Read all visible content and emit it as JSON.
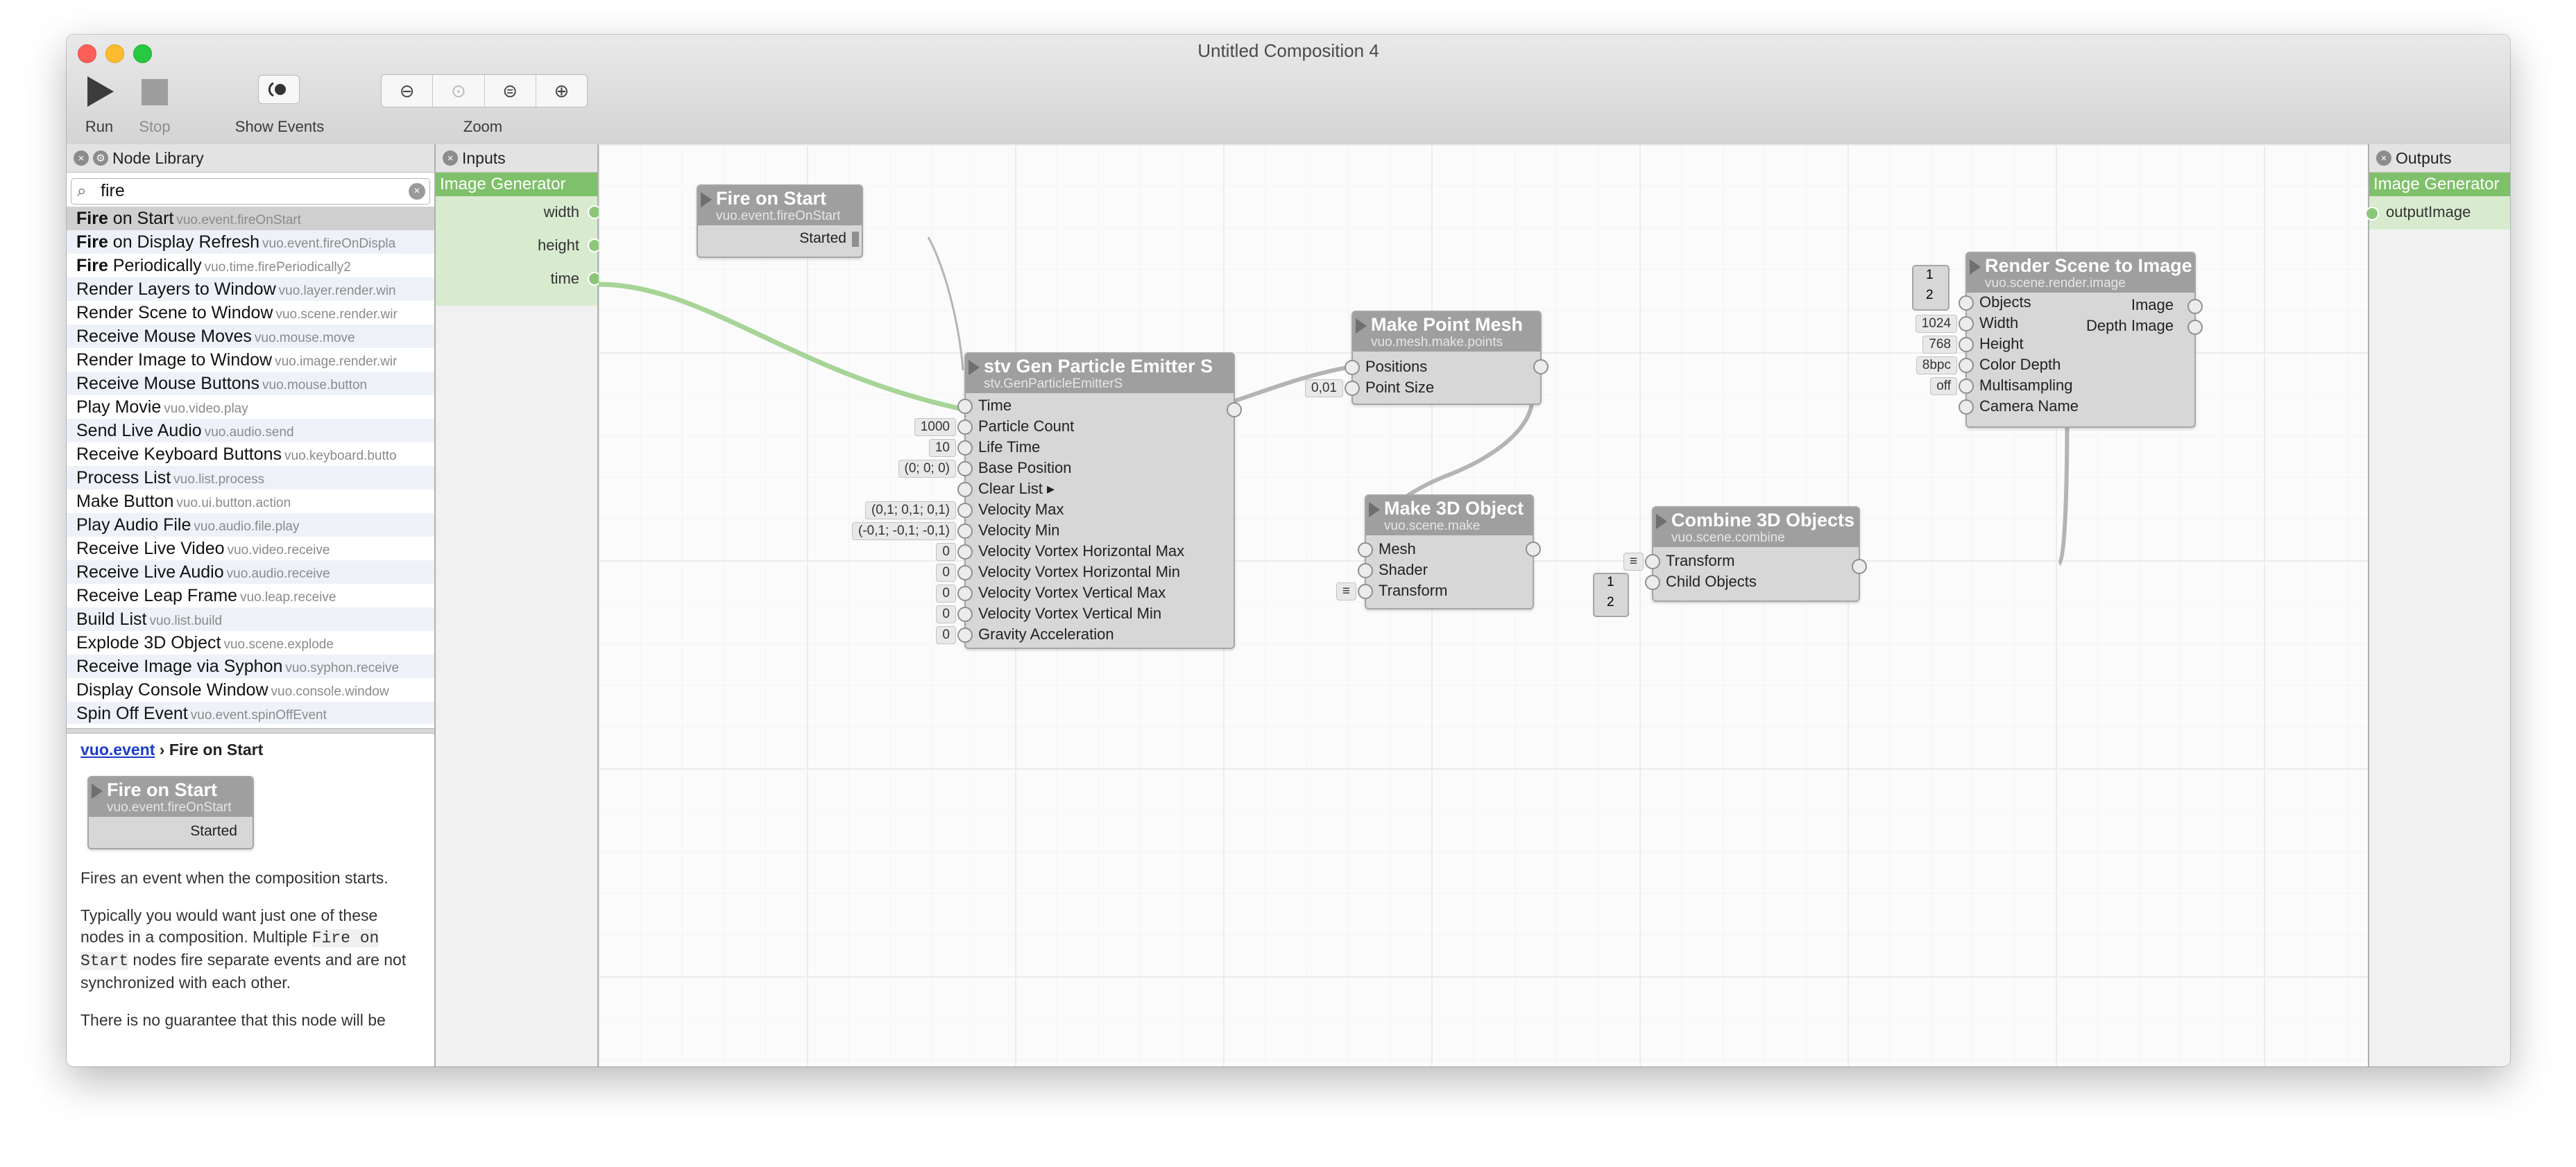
{
  "window": {
    "title": "Untitled Composition 4",
    "traffic_colors": [
      "#fc5f57",
      "#fdbc2e",
      "#28c840"
    ]
  },
  "toolbar": {
    "run_label": "Run",
    "stop_label": "Stop",
    "show_events_label": "Show Events",
    "zoom_label": "Zoom"
  },
  "node_library": {
    "title": "Node Library",
    "search_value": "fire",
    "items": [
      {
        "title": "Fire on Start",
        "cls": "vuo.event.fireOnStart",
        "selected": true
      },
      {
        "title": "Fire on Display Refresh",
        "cls": "vuo.event.fireOnDispla"
      },
      {
        "title": "Fire Periodically",
        "cls": "vuo.time.firePeriodically2"
      },
      {
        "title": "Render Layers to Window",
        "cls": "vuo.layer.render.win"
      },
      {
        "title": "Render Scene to Window",
        "cls": "vuo.scene.render.wir"
      },
      {
        "title": "Receive Mouse Moves",
        "cls": "vuo.mouse.move"
      },
      {
        "title": "Render Image to Window",
        "cls": "vuo.image.render.wir"
      },
      {
        "title": "Receive Mouse Buttons",
        "cls": "vuo.mouse.button"
      },
      {
        "title": "Play Movie",
        "cls": "vuo.video.play"
      },
      {
        "title": "Send Live Audio",
        "cls": "vuo.audio.send"
      },
      {
        "title": "Receive Keyboard Buttons",
        "cls": "vuo.keyboard.butto"
      },
      {
        "title": "Process List",
        "cls": "vuo.list.process"
      },
      {
        "title": "Make Button",
        "cls": "vuo.ui.button.action"
      },
      {
        "title": "Play Audio File",
        "cls": "vuo.audio.file.play"
      },
      {
        "title": "Receive Live Video",
        "cls": "vuo.video.receive"
      },
      {
        "title": "Receive Live Audio",
        "cls": "vuo.audio.receive"
      },
      {
        "title": "Receive Leap Frame",
        "cls": "vuo.leap.receive"
      },
      {
        "title": "Build List",
        "cls": "vuo.list.build"
      },
      {
        "title": "Explode 3D Object",
        "cls": "vuo.scene.explode"
      },
      {
        "title": "Receive Image via Syphon",
        "cls": "vuo.syphon.receive"
      },
      {
        "title": "Display Console Window",
        "cls": "vuo.console.window"
      },
      {
        "title": "Spin Off Event",
        "cls": "vuo.event.spinOffEvent"
      }
    ],
    "doc": {
      "crumb_link": "vuo.event",
      "crumb_sep": " › ",
      "crumb_title": "Fire on Start",
      "preview_title": "Fire on Start",
      "preview_class": "vuo.event.fireOnStart",
      "preview_port": "Started",
      "p1": "Fires an event when the composition starts.",
      "p2_a": "Typically you would want just one of these nodes in a composition. Multiple ",
      "p2_code1": "Fire on Start",
      "p2_b": " nodes fire separate events and are not synchronized with each other.",
      "p3": "There is no guarantee that this node will be"
    }
  },
  "inputs_panel": {
    "title": "Inputs",
    "section": "Image Generator",
    "ports": [
      "width",
      "height",
      "time"
    ]
  },
  "outputs_panel": {
    "title": "Outputs",
    "section": "Image Generator",
    "ports": [
      "outputImage"
    ]
  },
  "nodes": {
    "fire_on_start": {
      "title": "Fire on Start",
      "cls": "vuo.event.fireOnStart",
      "out": "Started"
    },
    "emitter": {
      "title": "stv Gen Particle Emitter S",
      "cls": "stv.GenParticleEmitterS",
      "ports": [
        {
          "label": "Time",
          "value": ""
        },
        {
          "label": "Particle Count",
          "value": "1000"
        },
        {
          "label": "Life Time",
          "value": "10"
        },
        {
          "label": "Base Position",
          "value": "(0; 0; 0)"
        },
        {
          "label": "Clear List ▸",
          "value": ""
        },
        {
          "label": "Velocity Max",
          "value": "(0,1; 0,1; 0,1)"
        },
        {
          "label": "Velocity Min",
          "value": "(-0,1; -0,1; -0,1)"
        },
        {
          "label": "Velocity Vortex Horizontal Max",
          "value": "0"
        },
        {
          "label": "Velocity Vortex Horizontal Min",
          "value": "0"
        },
        {
          "label": "Velocity Vortex Vertical Max",
          "value": "0"
        },
        {
          "label": "Velocity Vortex Vertical Min",
          "value": "0"
        },
        {
          "label": "Gravity Acceleration",
          "value": "0"
        }
      ]
    },
    "point_mesh": {
      "title": "Make Point Mesh",
      "cls": "vuo.mesh.make.points",
      "ports": [
        {
          "label": "Positions",
          "value": ""
        },
        {
          "label": "Point Size",
          "value": "0,01"
        }
      ]
    },
    "make_3d": {
      "title": "Make 3D Object",
      "cls": "vuo.scene.make",
      "ports": [
        {
          "label": "Mesh",
          "value": ""
        },
        {
          "label": "Shader",
          "value": ""
        },
        {
          "label": "Transform",
          "value": "≡"
        }
      ]
    },
    "combine": {
      "title": "Combine 3D Objects",
      "cls": "vuo.scene.combine",
      "ports": [
        {
          "label": "Transform",
          "value": "≡"
        },
        {
          "label": "Child Objects",
          "value": ""
        }
      ],
      "list_items": [
        "1",
        "2"
      ]
    },
    "render": {
      "title": "Render Scene to Image",
      "cls": "vuo.scene.render.image",
      "ports": [
        {
          "label": "Objects",
          "value": ""
        },
        {
          "label": "Width",
          "value": "1024"
        },
        {
          "label": "Height",
          "value": "768"
        },
        {
          "label": "Color Depth",
          "value": "8bpc"
        },
        {
          "label": "Multisampling",
          "value": "off"
        },
        {
          "label": "Camera Name",
          "value": ""
        }
      ],
      "outputs": [
        "Image",
        "Depth Image"
      ],
      "list_items": [
        "1",
        "2"
      ]
    }
  },
  "colors": {
    "accent_green": "#7fc06b",
    "node_header": "#9f9f9f",
    "node_body": "#d7d7d7"
  }
}
